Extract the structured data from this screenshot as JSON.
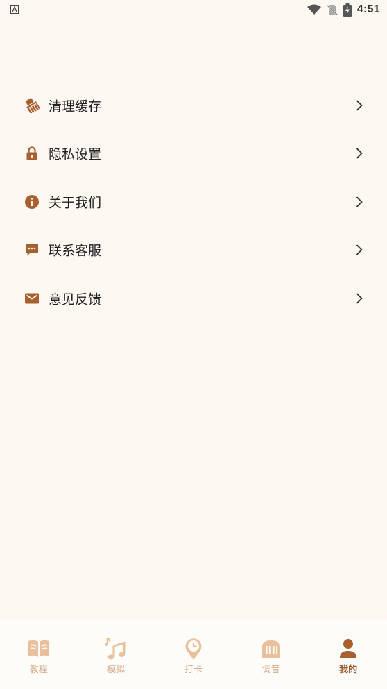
{
  "status_bar": {
    "time": "4:51",
    "left_icon": "keyboard-a-icon",
    "right_icons": [
      "wifi-icon",
      "no-sim-icon",
      "battery-charging-icon"
    ]
  },
  "colors": {
    "background": "#fdf8f2",
    "accent": "#a8602f",
    "nav_inactive": "#e8c09c",
    "nav_active": "#9b572b",
    "text": "#222222"
  },
  "menu": {
    "items": [
      {
        "label": "清理缓存",
        "icon": "broom-icon"
      },
      {
        "label": "隐私设置",
        "icon": "lock-icon"
      },
      {
        "label": "关于我们",
        "icon": "info-icon"
      },
      {
        "label": "联系客服",
        "icon": "chat-icon"
      },
      {
        "label": "意见反馈",
        "icon": "mail-icon"
      }
    ]
  },
  "bottom_nav": {
    "items": [
      {
        "label": "教程",
        "icon": "book-icon",
        "active": false
      },
      {
        "label": "模拟",
        "icon": "music-note-icon",
        "active": false
      },
      {
        "label": "打卡",
        "icon": "clock-pin-icon",
        "active": false
      },
      {
        "label": "调音",
        "icon": "piano-icon",
        "active": false
      },
      {
        "label": "我的",
        "icon": "person-icon",
        "active": true
      }
    ]
  }
}
